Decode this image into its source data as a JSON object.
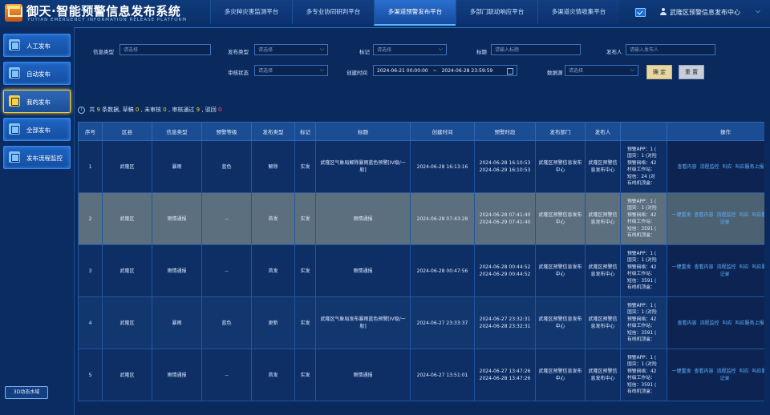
{
  "header": {
    "title": "御天·智能预警信息发布系统",
    "subtitle": "YUTIAN EMERGENCY INFORMATION RELEASE PLATFORM",
    "nav": [
      "多灾种灾害监测平台",
      "多专业协同研判平台",
      "多渠道预警发布平台",
      "多部门联动响应平台",
      "多渠道灾情收集平台"
    ],
    "active_nav": 2,
    "user": "武隆区预警信息发布中心",
    "user_arrow": "⌵"
  },
  "sidebar": {
    "items": [
      "人工发布",
      "自动发布",
      "我的发布",
      "全部发布",
      "发布流程监控"
    ],
    "active": 2,
    "bottom_button": "3D动态水域"
  },
  "filters": {
    "info_type_label": "信息类型",
    "info_type_placeholder": "请选择",
    "publish_type_label": "发布类型",
    "publish_type_placeholder": "请选择",
    "tag_label": "标记",
    "tag_placeholder": "请选择",
    "title_label": "标题",
    "title_placeholder": "请输入标题",
    "publisher_label": "发布人",
    "publisher_placeholder": "请输入发布人",
    "review_label": "审核状态",
    "review_placeholder": "请选择",
    "created_label": "创建时间",
    "created_start": "2024-06-21 00:00:00",
    "created_sep": "~",
    "created_end": "2024-06-28 23:59:59",
    "source_label": "数据源",
    "source_placeholder": "请选择",
    "ok_button": "确 定",
    "reset_button": "重 置"
  },
  "summary": {
    "p1": "共",
    "total": "9",
    "p2": "条数据, 草稿",
    "draft": "0",
    "p3": ", 未审核",
    "unreviewed": "0",
    "p4": ", 审核通过",
    "approved": "9",
    "p5": ", 驳回",
    "rejected": "0"
  },
  "table": {
    "columns": [
      "序号",
      "区县",
      "信息类型",
      "预警等级",
      "发布类型",
      "标记",
      "标题",
      "创建时间",
      "预警时段",
      "发布部门",
      "发布人",
      "",
      "操作"
    ],
    "rows": [
      {
        "no": "1",
        "district": "武隆区",
        "type": "暴雨",
        "level": "蓝色",
        "pubtype": "解除",
        "tag": "实发",
        "title": "武隆区气象局解除暴雨蓝色预警[IV级/一般]",
        "created": "2024-06-28 16:13:16",
        "period_start": "2024-06-28 16:10:53",
        "period_end": "2024-06-29 16:10:53",
        "dept": "武隆区预警信息发布中心",
        "publisher": "武隆区预警信息发布中心",
        "stats": [
          "预警APP：1 (",
          "国突：1 (对险",
          "预警网络：42",
          "村级工作站：",
          "短信：24 (对",
          "有线机顶盒："
        ],
        "ops": [
          "查看内容",
          "流程监控",
          "叫应",
          "叫应服务上报记录"
        ]
      },
      {
        "no": "2",
        "district": "武隆区",
        "type": "雨情通报",
        "level": "--",
        "pubtype": "首发",
        "tag": "实发",
        "title": "雨情通报",
        "created": "2024-06-28 07:43:28",
        "period_start": "2024-06-28 07:41:40",
        "period_end": "2024-06-29 07:41:40",
        "dept": "武隆区预警信息发布中心",
        "publisher": "武隆区预警信息发布中心",
        "stats": [
          "预警APP：1 (",
          "国突：1 (对险",
          "预警网络：42",
          "村级工作站：",
          "短信：3591 (",
          "有线机顶盒："
        ],
        "ops": [
          "一键重发",
          "查看内容",
          "流程监控",
          "叫应",
          "叫应服务上报记录"
        ]
      },
      {
        "no": "3",
        "district": "武隆区",
        "type": "雨情通报",
        "level": "--",
        "pubtype": "首发",
        "tag": "实发",
        "title": "雨情通报",
        "created": "2024-06-28 00:47:56",
        "period_start": "2024-06-28 00:44:52",
        "period_end": "2024-06-29 00:44:52",
        "dept": "武隆区预警信息发布中心",
        "publisher": "武隆区预警信息发布中心",
        "stats": [
          "预警APP：1 (",
          "国突：1 (对险",
          "预警网络：42",
          "村级工作站：",
          "短信：3591 (",
          "有线机顶盒："
        ],
        "ops": [
          "一键重发",
          "查看内容",
          "流程监控",
          "叫应",
          "叫应服务上报记录"
        ]
      },
      {
        "no": "4",
        "district": "武隆区",
        "type": "暴雨",
        "level": "蓝色",
        "pubtype": "更新",
        "tag": "实发",
        "title": "武隆区气象局发布暴雨蓝色预警[IV级/一般]",
        "created": "2024-06-27 23:33:37",
        "period_start": "2024-06-27 23:32:31",
        "period_end": "2024-06-28 23:32:31",
        "dept": "武隆区预警信息发布中心",
        "publisher": "武隆区预警信息发布中心",
        "stats": [
          "预警APP：1 (",
          "国突：1 (对险",
          "预警网络：42",
          "村级工作站：",
          "短信：3591 (",
          "有线机顶盒："
        ],
        "ops": [
          "查看内容",
          "流程监控",
          "叫应",
          "叫应服务上报记录"
        ]
      },
      {
        "no": "5",
        "district": "武隆区",
        "type": "雨情通报",
        "level": "--",
        "pubtype": "首发",
        "tag": "实发",
        "title": "雨情通报",
        "created": "2024-06-27 13:51:01",
        "period_start": "2024-06-27 13:47:26",
        "period_end": "2024-06-28 13:47:26",
        "dept": "武隆区预警信息发布中心",
        "publisher": "武隆区预警信息发布中心",
        "stats": [
          "预警APP：1 (",
          "国突：1 (对险",
          "预警网络：42",
          "村级工作站：",
          "短信：3591 (",
          "有线机顶盒："
        ],
        "ops": [
          "一键重发",
          "查看内容",
          "流程监控",
          "叫应",
          "叫应服务上报记录"
        ]
      }
    ],
    "selected_row": 1
  }
}
